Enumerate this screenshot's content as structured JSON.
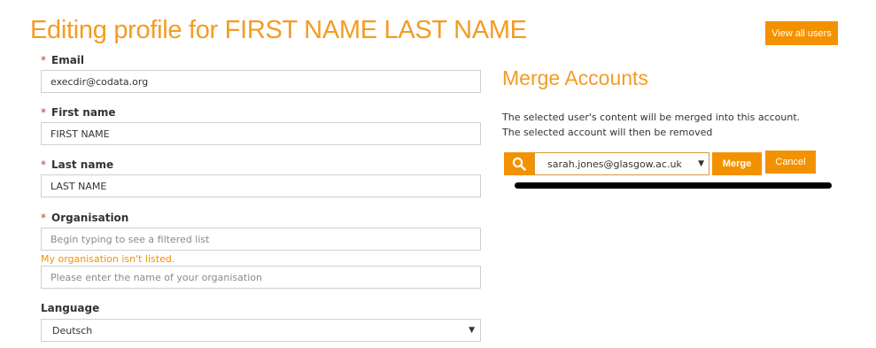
{
  "header": {
    "title": "Editing profile for FIRST NAME LAST NAME",
    "view_all_label": "View all users"
  },
  "form": {
    "email": {
      "label": "Email",
      "value": "execdir@codata.org",
      "required": true
    },
    "first_name": {
      "label": "First name",
      "value": "FIRST NAME",
      "required": true
    },
    "last_name": {
      "label": "Last name",
      "value": "LAST NAME",
      "required": true
    },
    "organisation": {
      "label": "Organisation",
      "placeholder": "Begin typing to see a filtered list",
      "not_listed_link": "My organisation isn't listed.",
      "other_placeholder": "Please enter the name of your organisation",
      "required": true
    },
    "language": {
      "label": "Language",
      "selected": "Deutsch"
    },
    "required_marker": "*"
  },
  "merge": {
    "title": "Merge Accounts",
    "description_line1": "The selected user's content will be merged into this account.",
    "description_line2": "The selected account will then be removed",
    "selected_user": "sarah.jones@glasgow.ac.uk",
    "merge_label": "Merge",
    "cancel_label": "Cancel"
  },
  "icons": {
    "search": "search-icon",
    "dropdown": "chevron-down-icon"
  },
  "colors": {
    "accent": "#f39200",
    "title": "#f39c24",
    "required": "#c0392b"
  }
}
